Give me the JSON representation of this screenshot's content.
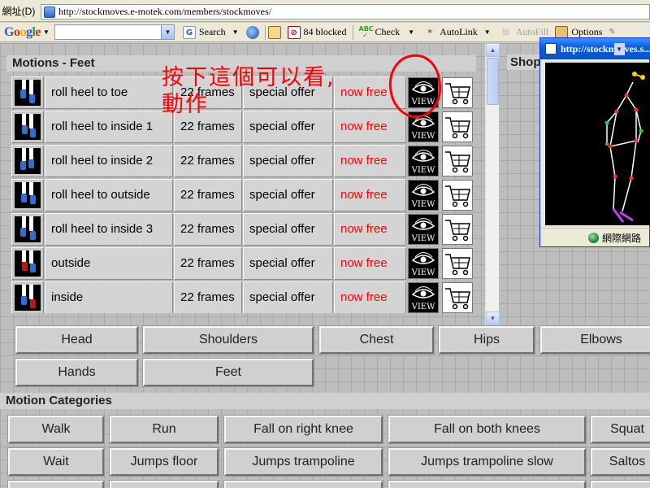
{
  "browser": {
    "address_label": "網址(D)",
    "url": "http://stockmoves.e-motek.com/members/stockmoves/"
  },
  "google_toolbar": {
    "logo": "Google",
    "search_label": "Search",
    "blocked_label": "84 blocked",
    "check_label": "Check",
    "autolink_label": "AutoLink",
    "autofill_label": "AutoFill",
    "options_label": "Options"
  },
  "motions": {
    "title": "Motions - Feet",
    "rows": [
      {
        "name": "roll heel to toe",
        "frames": "22 frames",
        "offer": "special offer",
        "price": "now free"
      },
      {
        "name": "roll heel to inside 1",
        "frames": "22 frames",
        "offer": "special offer",
        "price": "now free"
      },
      {
        "name": "roll heel to inside 2",
        "frames": "22 frames",
        "offer": "special offer",
        "price": "now free"
      },
      {
        "name": "roll heel to outside",
        "frames": "22 frames",
        "offer": "special offer",
        "price": "now free"
      },
      {
        "name": "roll heel to inside 3",
        "frames": "22 frames",
        "offer": "special offer",
        "price": "now free"
      },
      {
        "name": "outside",
        "frames": "22 frames",
        "offer": "special offer",
        "price": "now free"
      },
      {
        "name": "inside",
        "frames": "22 frames",
        "offer": "special offer",
        "price": "now free"
      },
      {
        "name": "",
        "frames": "",
        "offer": "",
        "price": ""
      }
    ],
    "view_label": "VIEW"
  },
  "annotation": {
    "line1": "按下這個可以看,",
    "line2": "動作"
  },
  "shop_label": "Shop",
  "body_parts": {
    "head": "Head",
    "shoulders": "Shoulders",
    "chest": "Chest",
    "hips": "Hips",
    "elbows": "Elbows",
    "hands": "Hands",
    "feet": "Feet"
  },
  "categories": {
    "title": "Motion Categories",
    "walk": "Walk",
    "run": "Run",
    "fall_right_knee": "Fall on right knee",
    "fall_both_knees": "Fall on both knees",
    "squat": "Squat",
    "wait": "Wait",
    "jumps_floor": "Jumps floor",
    "jumps_trampoline": "Jumps trampoline",
    "jumps_trampoline_slow": "Jumps trampoline slow",
    "saltos": "Saltos"
  },
  "popup": {
    "title": "http://stockm",
    "title_rest": "ves.s...",
    "status": "網際網路"
  },
  "colors": {
    "price_red": "#ff0000",
    "annotation_red": "#ff0000",
    "foot_blue": "#2d6fd6",
    "grid_bg": "#bdbdbd"
  }
}
